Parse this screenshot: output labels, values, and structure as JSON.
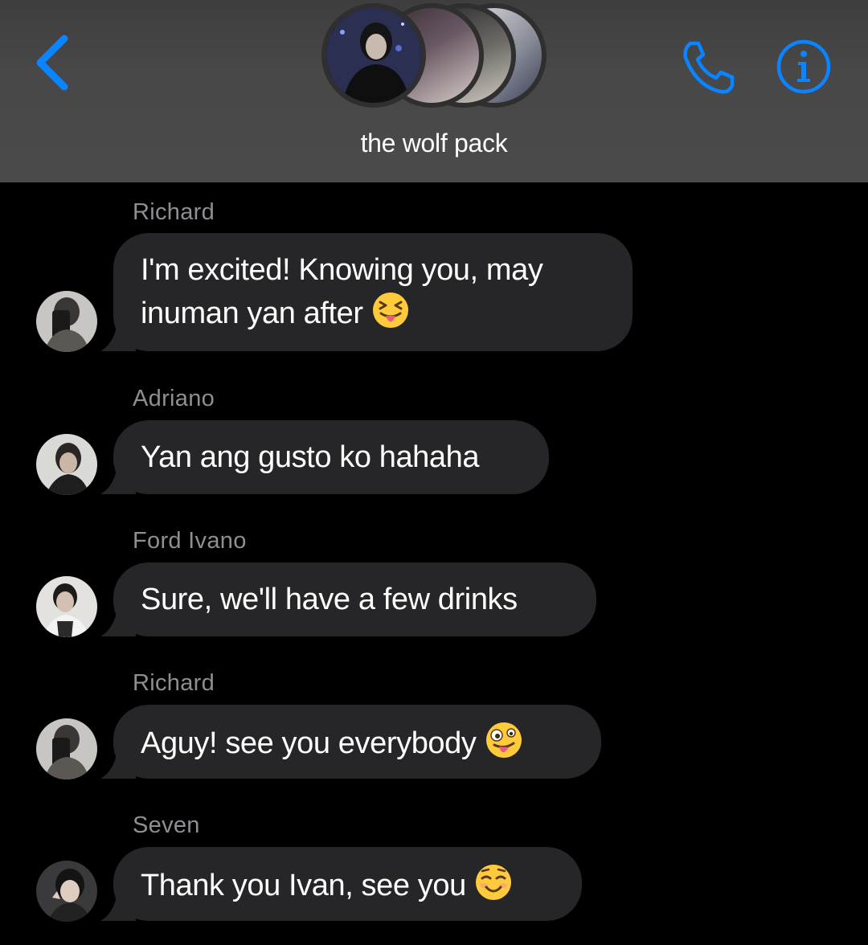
{
  "header": {
    "title": "the wolf pack",
    "back_icon": "chevron-left-icon",
    "call_icon": "phone-icon",
    "info_icon": "info-icon",
    "accent_color": "#0a84ff"
  },
  "messages": [
    {
      "sender": "Richard",
      "text": "I'm excited! Knowing you, may",
      "text2": "inuman yan after",
      "emoji": "squinting-face-with-tongue"
    },
    {
      "sender": "Adriano",
      "text": "Yan ang gusto ko hahaha"
    },
    {
      "sender": "Ford Ivano",
      "text": "Sure, we'll have a few drinks"
    },
    {
      "sender": "Richard",
      "text": "Aguy! see you everybody",
      "emoji": "zany-face"
    },
    {
      "sender": "Seven",
      "text": "Thank you Ivan, see you",
      "emoji": "smiling-face"
    }
  ],
  "colors": {
    "bubble": "#262628",
    "background": "#000000",
    "sender_name": "#8e8e93"
  }
}
